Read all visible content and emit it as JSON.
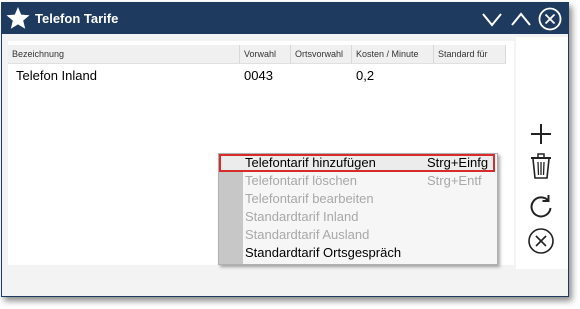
{
  "window": {
    "title": "Telefon Tarife"
  },
  "table": {
    "headers": [
      "Bezeichnung",
      "Vorwahl",
      "Ortsvorwahl",
      "Kosten / Minute",
      "Standard für"
    ],
    "rows": [
      {
        "bezeichnung": "Telefon Inland",
        "vorwahl": "0043",
        "ortsvorwahl": "",
        "kosten": "0,2",
        "standard": ""
      }
    ]
  },
  "sidebar": {
    "icons": [
      "plus-icon",
      "trash-icon",
      "refresh-icon",
      "close-circle-icon"
    ]
  },
  "context_menu": {
    "items": [
      {
        "label": "Telefontarif hinzufügen",
        "shortcut": "Strg+Einfg",
        "enabled": true
      },
      {
        "label": "Telefontarif löschen",
        "shortcut": "Strg+Entf",
        "enabled": false
      },
      {
        "label": "Telefontarif bearbeiten",
        "shortcut": "",
        "enabled": false
      },
      {
        "label": "Standardtarif Inland",
        "shortcut": "",
        "enabled": false
      },
      {
        "label": "Standardtarif Ausland",
        "shortcut": "",
        "enabled": false
      },
      {
        "label": "Standardtarif Ortsgespräch",
        "shortcut": "",
        "enabled": true
      }
    ]
  },
  "colors": {
    "titlebar": "#1e3a5f",
    "highlight_border": "#d62c2c"
  }
}
